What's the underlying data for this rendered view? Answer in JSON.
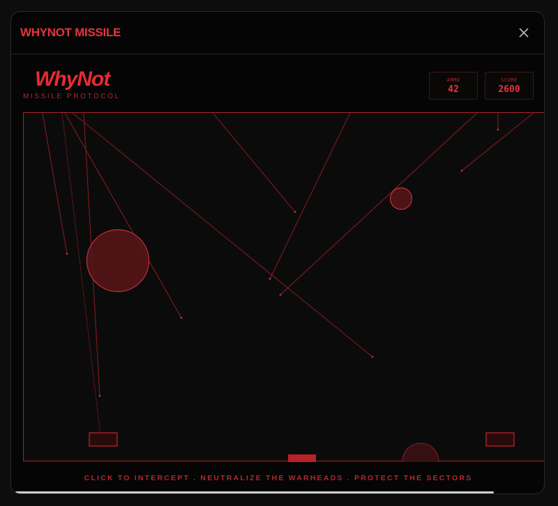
{
  "modal": {
    "title": "WHYNOT MISSILE",
    "close_icon": "close-icon"
  },
  "logo": {
    "name": "WhyNot",
    "tagline": "MISSILE PROTOCOL"
  },
  "stats": {
    "ammo_label": "AMMO",
    "ammo_value": "42",
    "score_label": "SCORE",
    "score_value": "2600"
  },
  "instructions": "CLICK TO INTERCEPT . NEUTRALIZE THE WARHEADS . PROTECT THE SECTORS",
  "colors": {
    "accent": "#e8333b",
    "trail": "#7a1a1f",
    "explosion_fill": "#5a1518",
    "explosion_stroke": "#c0303a"
  },
  "game": {
    "city_count": 2,
    "launcher_count": 1
  }
}
